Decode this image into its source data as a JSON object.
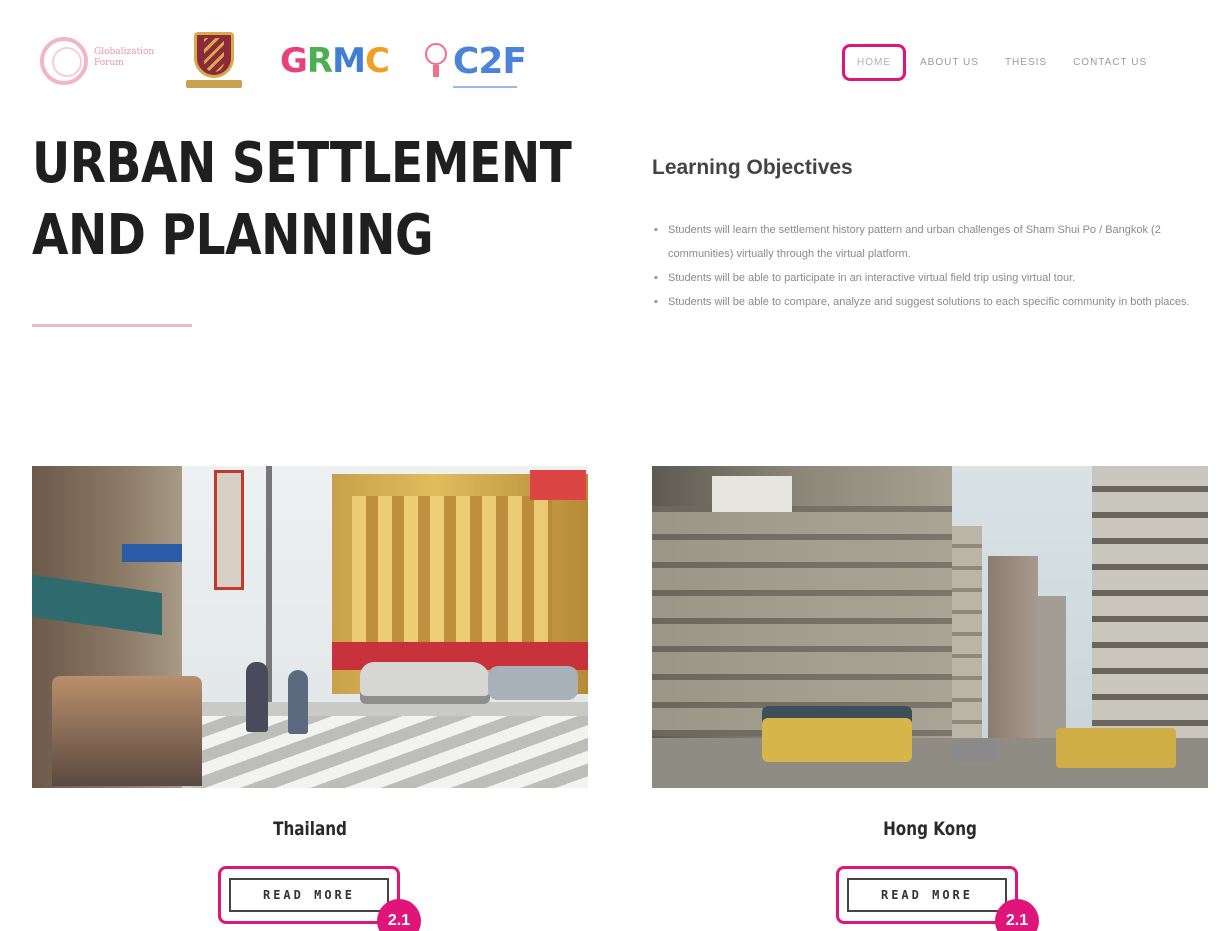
{
  "header": {
    "logos": [
      {
        "name": "ring-logo",
        "text_lines": [
          "Globalization",
          "Forum"
        ]
      },
      {
        "name": "university-crest-logo"
      },
      {
        "name": "grmc-logo",
        "text": "GRMC",
        "colors": [
          "#e8407a",
          "#4caf50",
          "#3f7fd4",
          "#f0a020"
        ]
      },
      {
        "name": "c2f-logo",
        "text": "C2F"
      }
    ],
    "nav": [
      {
        "label": "HOME",
        "active": true
      },
      {
        "label": "ABOUT US",
        "active": false
      },
      {
        "label": "THESIS",
        "active": false
      },
      {
        "label": "CONTACT US",
        "active": false
      }
    ]
  },
  "hero": {
    "title_line1": "URBAN SETTLEMENT",
    "title_line2": "AND PLANNING"
  },
  "objectives": {
    "heading": "Learning Objectives",
    "items": [
      "Students will learn the settlement history pattern and urban challenges of Sham Shui Po / Bangkok (2 communities) virtually through the virtual platform.",
      "Students will be able to participate in an interactive virtual field trip using virtual tour.",
      "Students will be able to compare, analyze and suggest solutions to each specific community in both places."
    ]
  },
  "cards": [
    {
      "title": "Thailand",
      "button_label": "READ MORE",
      "badge": "2.1"
    },
    {
      "title": "Hong Kong",
      "button_label": "READ MORE",
      "badge": "2.1"
    }
  ],
  "colors": {
    "highlight": "#e0157a",
    "accent_line": "#f2b6c8",
    "heading": "#1f1f1f"
  }
}
